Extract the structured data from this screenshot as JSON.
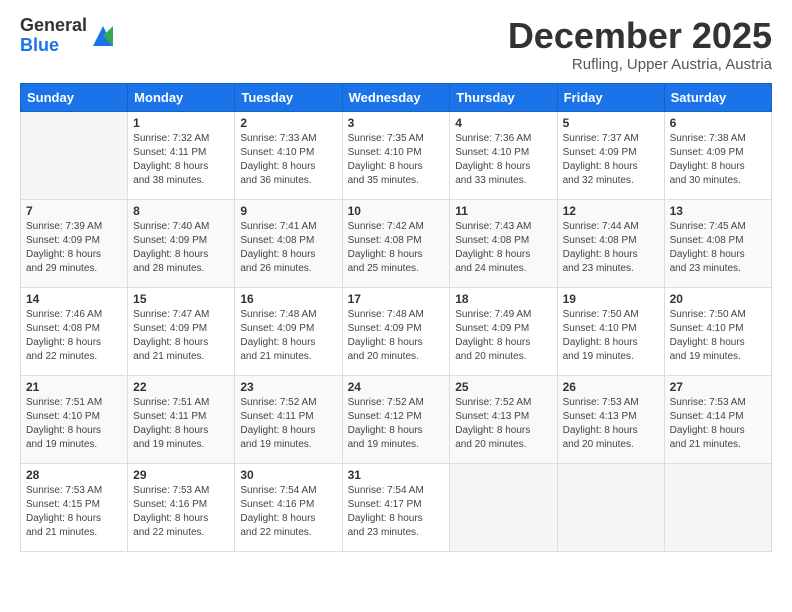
{
  "logo": {
    "general": "General",
    "blue": "Blue"
  },
  "title": "December 2025",
  "location": "Rufling, Upper Austria, Austria",
  "days_of_week": [
    "Sunday",
    "Monday",
    "Tuesday",
    "Wednesday",
    "Thursday",
    "Friday",
    "Saturday"
  ],
  "weeks": [
    [
      {
        "num": "",
        "info": ""
      },
      {
        "num": "1",
        "info": "Sunrise: 7:32 AM\nSunset: 4:11 PM\nDaylight: 8 hours\nand 38 minutes."
      },
      {
        "num": "2",
        "info": "Sunrise: 7:33 AM\nSunset: 4:10 PM\nDaylight: 8 hours\nand 36 minutes."
      },
      {
        "num": "3",
        "info": "Sunrise: 7:35 AM\nSunset: 4:10 PM\nDaylight: 8 hours\nand 35 minutes."
      },
      {
        "num": "4",
        "info": "Sunrise: 7:36 AM\nSunset: 4:10 PM\nDaylight: 8 hours\nand 33 minutes."
      },
      {
        "num": "5",
        "info": "Sunrise: 7:37 AM\nSunset: 4:09 PM\nDaylight: 8 hours\nand 32 minutes."
      },
      {
        "num": "6",
        "info": "Sunrise: 7:38 AM\nSunset: 4:09 PM\nDaylight: 8 hours\nand 30 minutes."
      }
    ],
    [
      {
        "num": "7",
        "info": "Sunrise: 7:39 AM\nSunset: 4:09 PM\nDaylight: 8 hours\nand 29 minutes."
      },
      {
        "num": "8",
        "info": "Sunrise: 7:40 AM\nSunset: 4:09 PM\nDaylight: 8 hours\nand 28 minutes."
      },
      {
        "num": "9",
        "info": "Sunrise: 7:41 AM\nSunset: 4:08 PM\nDaylight: 8 hours\nand 26 minutes."
      },
      {
        "num": "10",
        "info": "Sunrise: 7:42 AM\nSunset: 4:08 PM\nDaylight: 8 hours\nand 25 minutes."
      },
      {
        "num": "11",
        "info": "Sunrise: 7:43 AM\nSunset: 4:08 PM\nDaylight: 8 hours\nand 24 minutes."
      },
      {
        "num": "12",
        "info": "Sunrise: 7:44 AM\nSunset: 4:08 PM\nDaylight: 8 hours\nand 23 minutes."
      },
      {
        "num": "13",
        "info": "Sunrise: 7:45 AM\nSunset: 4:08 PM\nDaylight: 8 hours\nand 23 minutes."
      }
    ],
    [
      {
        "num": "14",
        "info": "Sunrise: 7:46 AM\nSunset: 4:08 PM\nDaylight: 8 hours\nand 22 minutes."
      },
      {
        "num": "15",
        "info": "Sunrise: 7:47 AM\nSunset: 4:09 PM\nDaylight: 8 hours\nand 21 minutes."
      },
      {
        "num": "16",
        "info": "Sunrise: 7:48 AM\nSunset: 4:09 PM\nDaylight: 8 hours\nand 21 minutes."
      },
      {
        "num": "17",
        "info": "Sunrise: 7:48 AM\nSunset: 4:09 PM\nDaylight: 8 hours\nand 20 minutes."
      },
      {
        "num": "18",
        "info": "Sunrise: 7:49 AM\nSunset: 4:09 PM\nDaylight: 8 hours\nand 20 minutes."
      },
      {
        "num": "19",
        "info": "Sunrise: 7:50 AM\nSunset: 4:10 PM\nDaylight: 8 hours\nand 19 minutes."
      },
      {
        "num": "20",
        "info": "Sunrise: 7:50 AM\nSunset: 4:10 PM\nDaylight: 8 hours\nand 19 minutes."
      }
    ],
    [
      {
        "num": "21",
        "info": "Sunrise: 7:51 AM\nSunset: 4:10 PM\nDaylight: 8 hours\nand 19 minutes."
      },
      {
        "num": "22",
        "info": "Sunrise: 7:51 AM\nSunset: 4:11 PM\nDaylight: 8 hours\nand 19 minutes."
      },
      {
        "num": "23",
        "info": "Sunrise: 7:52 AM\nSunset: 4:11 PM\nDaylight: 8 hours\nand 19 minutes."
      },
      {
        "num": "24",
        "info": "Sunrise: 7:52 AM\nSunset: 4:12 PM\nDaylight: 8 hours\nand 19 minutes."
      },
      {
        "num": "25",
        "info": "Sunrise: 7:52 AM\nSunset: 4:13 PM\nDaylight: 8 hours\nand 20 minutes."
      },
      {
        "num": "26",
        "info": "Sunrise: 7:53 AM\nSunset: 4:13 PM\nDaylight: 8 hours\nand 20 minutes."
      },
      {
        "num": "27",
        "info": "Sunrise: 7:53 AM\nSunset: 4:14 PM\nDaylight: 8 hours\nand 21 minutes."
      }
    ],
    [
      {
        "num": "28",
        "info": "Sunrise: 7:53 AM\nSunset: 4:15 PM\nDaylight: 8 hours\nand 21 minutes."
      },
      {
        "num": "29",
        "info": "Sunrise: 7:53 AM\nSunset: 4:16 PM\nDaylight: 8 hours\nand 22 minutes."
      },
      {
        "num": "30",
        "info": "Sunrise: 7:54 AM\nSunset: 4:16 PM\nDaylight: 8 hours\nand 22 minutes."
      },
      {
        "num": "31",
        "info": "Sunrise: 7:54 AM\nSunset: 4:17 PM\nDaylight: 8 hours\nand 23 minutes."
      },
      {
        "num": "",
        "info": ""
      },
      {
        "num": "",
        "info": ""
      },
      {
        "num": "",
        "info": ""
      }
    ]
  ]
}
